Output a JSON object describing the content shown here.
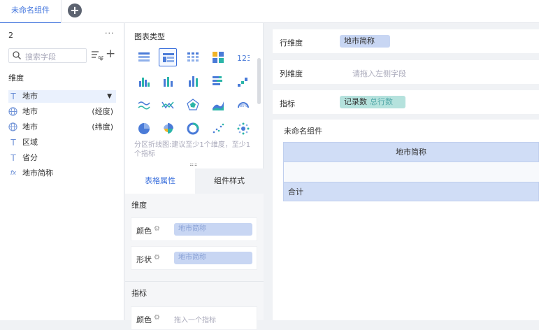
{
  "tabbar": {
    "active_tab": "未命名组件",
    "add_icon": "plus-circle-icon"
  },
  "left": {
    "dataset_name": "2",
    "more_label": "···",
    "search_placeholder": "搜索字段",
    "dimension_title": "维度",
    "fields": [
      {
        "type_icon": "T",
        "name": "地市",
        "suffix": "",
        "selected": true
      },
      {
        "type_icon": "globe",
        "name": "地市",
        "suffix": "(经度)"
      },
      {
        "type_icon": "globe",
        "name": "地市",
        "suffix": "(纬度)"
      },
      {
        "type_icon": "T",
        "name": "区域",
        "suffix": ""
      },
      {
        "type_icon": "T",
        "name": "省分",
        "suffix": ""
      },
      {
        "type_icon": "fx",
        "name": "地市简称",
        "suffix": ""
      }
    ]
  },
  "middle": {
    "chart_type_title": "图表类型",
    "hint": "分区折线图:建议至少1个维度，至少1个指标",
    "tabs": {
      "table_props": "表格属性",
      "component_style": "组件样式"
    },
    "dimension_section": "维度",
    "color_label": "颜色",
    "color_value": "地市简称",
    "shape_label": "形状",
    "shape_value": "地市简称",
    "metric_section": "指标",
    "metric_color_label": "颜色",
    "metric_color_placeholder": "拖入一个指标"
  },
  "right": {
    "row_dim_label": "行维度",
    "row_dim_chip": "地市简称",
    "col_dim_label": "列维度",
    "col_dim_placeholder": "请拖入左侧字段",
    "metric_label": "指标",
    "metric_chip": "记录数",
    "metric_chip_sub": "总行数",
    "component_name": "未命名组件",
    "table_header": "地市简称",
    "total_label": "合计"
  },
  "colors": {
    "accent": "#3a6fdc",
    "dim_chip": "#c8d6f3",
    "metric_chip": "#b5e2dd"
  }
}
